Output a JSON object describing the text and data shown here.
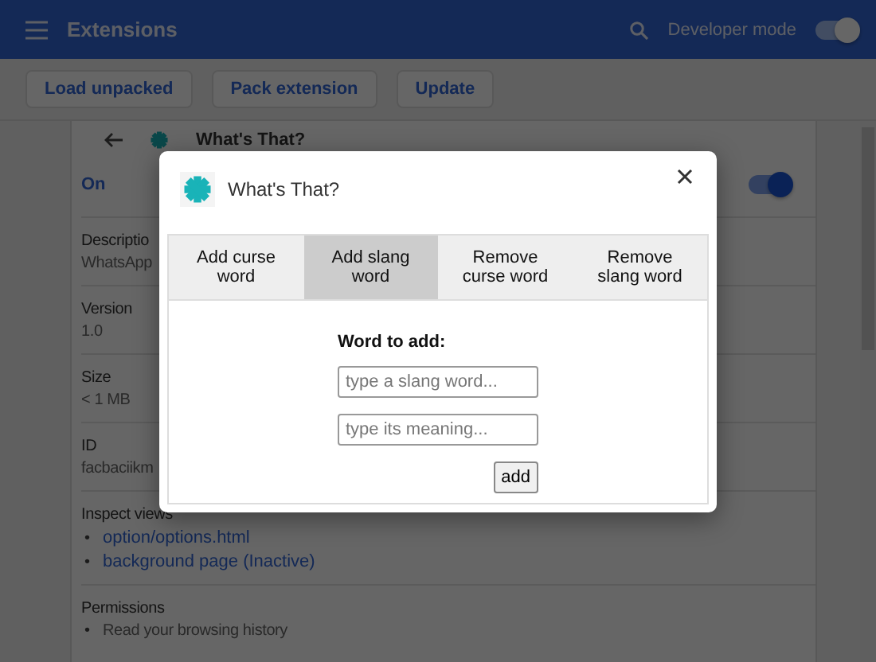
{
  "topbar": {
    "title": "Extensions",
    "developer_mode": {
      "label": "Developer mode",
      "on": true
    }
  },
  "toolbar": {
    "buttons": [
      "Load unpacked",
      "Pack extension",
      "Update"
    ]
  },
  "detail": {
    "title": "What's That?",
    "status": {
      "label": "On",
      "on": true
    },
    "sections": [
      {
        "kind": "text",
        "label": "Descriptio",
        "value": "WhatsApp"
      },
      {
        "kind": "text",
        "label": "Version",
        "value": "1.0"
      },
      {
        "kind": "text",
        "label": "Size",
        "value": "< 1 MB"
      },
      {
        "kind": "text",
        "label": "ID",
        "value": "facbaciikm"
      },
      {
        "kind": "links",
        "label": "Inspect views",
        "marker": "•",
        "items": [
          "option/options.html",
          "background page (Inactive)"
        ]
      },
      {
        "kind": "bullets",
        "label": "Permissions",
        "marker": "•",
        "items": [
          "Read your browsing history"
        ]
      }
    ]
  },
  "dialog": {
    "title": "What's That?",
    "tabs": [
      {
        "label": "Add curse word",
        "selected": false
      },
      {
        "label": "Add slang word",
        "selected": true
      },
      {
        "label": "Remove curse word",
        "selected": false
      },
      {
        "label": "Remove slang word",
        "selected": false
      }
    ],
    "form": {
      "heading": "Word to add:",
      "fields": [
        {
          "placeholder": "type a slang word..."
        },
        {
          "placeholder": "type its meaning..."
        }
      ],
      "button": "add"
    }
  }
}
